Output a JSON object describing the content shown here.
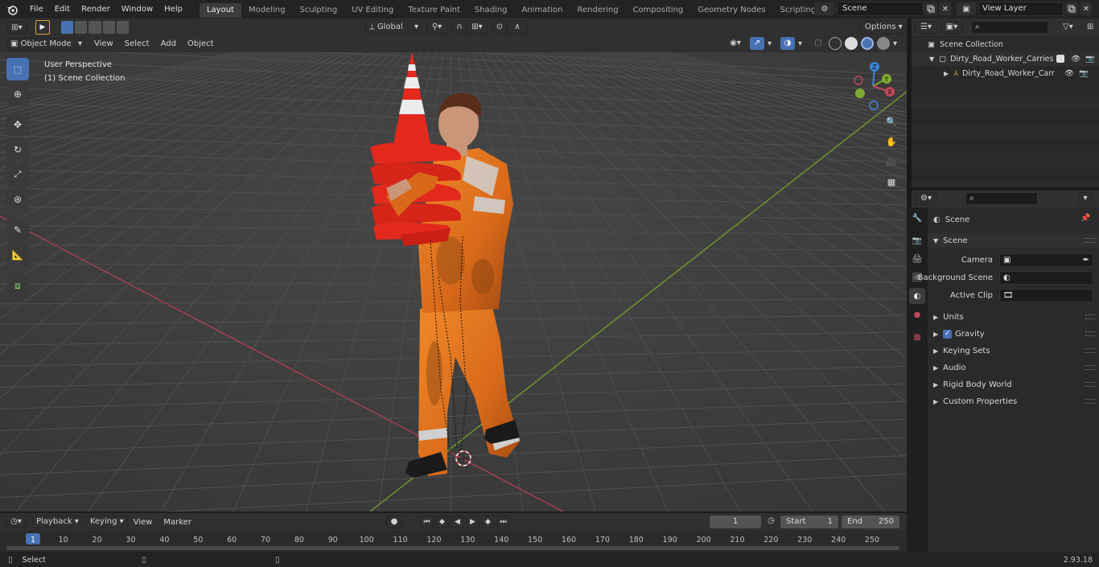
{
  "menu": [
    "File",
    "Edit",
    "Render",
    "Window",
    "Help"
  ],
  "workspace_tabs": [
    "Layout",
    "Modeling",
    "Sculpting",
    "UV Editing",
    "Texture Paint",
    "Shading",
    "Animation",
    "Rendering",
    "Compositing",
    "Geometry Nodes",
    "Scripting"
  ],
  "active_workspace": "Layout",
  "scene_name": "Scene",
  "view_layer_name": "View Layer",
  "viewport_header": {
    "mode": "Object Mode",
    "menus": [
      "View",
      "Select",
      "Add",
      "Object"
    ],
    "transform_orientation": "Global",
    "options_label": "Options"
  },
  "viewport_overlay": {
    "perspective": "User Perspective",
    "collection": "(1) Scene Collection"
  },
  "gizmo_axes": {
    "z": "Z",
    "y": "Y",
    "x": "X"
  },
  "outliner": {
    "root": "Scene Collection",
    "items": [
      {
        "label": "Dirty_Road_Worker_Carries_C"
      },
      {
        "label": "Dirty_Road_Worker_Carr"
      }
    ]
  },
  "properties": {
    "context_title": "Scene",
    "panel_title": "Scene",
    "fields": [
      {
        "label": "Camera",
        "value": ""
      },
      {
        "label": "Background Scene",
        "value": ""
      },
      {
        "label": "Active Clip",
        "value": ""
      }
    ],
    "subpanels": [
      "Units",
      "Gravity",
      "Keying Sets",
      "Audio",
      "Rigid Body World",
      "Custom Properties"
    ],
    "gravity_checked": true
  },
  "timeline_header": {
    "menus": [
      "Playback",
      "Keying",
      "View",
      "Marker"
    ],
    "current_frame": "1",
    "start_label": "Start",
    "start_value": "1",
    "end_label": "End",
    "end_value": "250"
  },
  "timeline_ticks": [
    "1",
    "10",
    "20",
    "30",
    "40",
    "50",
    "60",
    "70",
    "80",
    "90",
    "100",
    "110",
    "120",
    "130",
    "140",
    "150",
    "160",
    "170",
    "180",
    "190",
    "200",
    "210",
    "220",
    "230",
    "240",
    "250"
  ],
  "status": {
    "left": "Select",
    "version": "2.93.18"
  },
  "colors": {
    "accent": "#4772b3",
    "x_axis": "#c2455a",
    "y_axis": "#7fa832",
    "z_axis": "#3d82d6",
    "vest": "#e8751f",
    "cone": "#e3291c"
  }
}
